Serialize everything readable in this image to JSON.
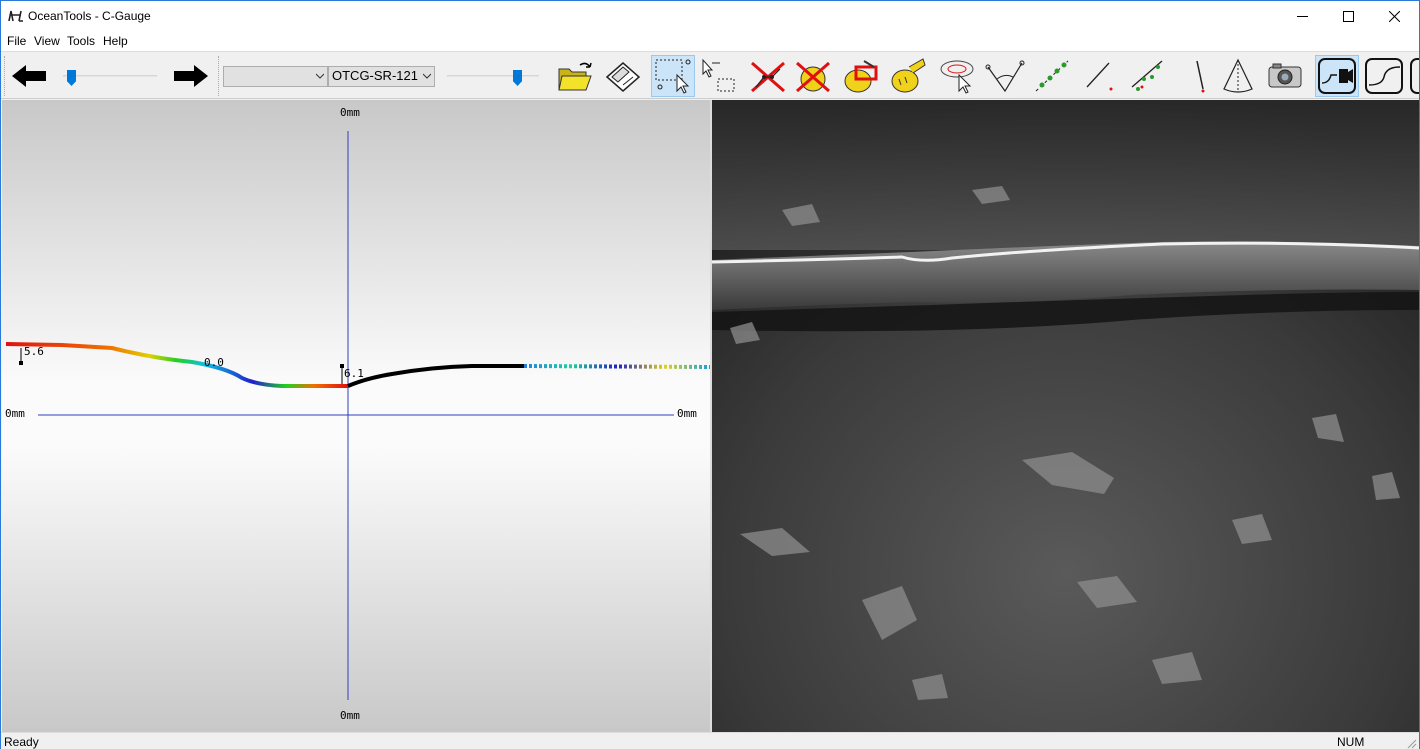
{
  "window": {
    "title": "OceanTools - C-Gauge",
    "controls": [
      "minimize-icon",
      "maximize-icon",
      "close-icon"
    ]
  },
  "menu": {
    "items": [
      {
        "label": "File"
      },
      {
        "label": "View"
      },
      {
        "label": "Tools"
      },
      {
        "label": "Help"
      }
    ]
  },
  "toolbar": {
    "prev_icon": "arrow-left-icon",
    "next_icon": "arrow-right-icon",
    "combo1_value": "",
    "combo2_value": "OTCG-SR-121",
    "tools": [
      {
        "icon": "open-folder-icon"
      },
      {
        "icon": "save-disk-icon"
      },
      {
        "icon": "select-points-icon"
      },
      {
        "icon": "select-rectangle-icon"
      },
      {
        "icon": "delete-points-icon"
      },
      {
        "icon": "delete-all-icon"
      },
      {
        "icon": "clear-measure-icon"
      },
      {
        "icon": "tape-measure-icon"
      },
      {
        "icon": "rotate-icon"
      },
      {
        "icon": "angle-icon"
      },
      {
        "icon": "point-line-icon"
      },
      {
        "icon": "line-icon"
      },
      {
        "icon": "point-fit-icon"
      },
      {
        "icon": "vertical-line-icon"
      },
      {
        "icon": "cone-icon"
      },
      {
        "icon": "camera-icon"
      },
      {
        "icon": "profile-camera-icon"
      },
      {
        "icon": "curve-icon"
      }
    ],
    "active_tools": [
      "select-points-icon",
      "profile-camera-icon"
    ]
  },
  "profile": {
    "top_axis_label": "0mm",
    "bottom_axis_label": "0mm",
    "left_axis_label": "0mm",
    "right_axis_label": "0mm",
    "measure_labels": [
      "5.6",
      "0.0",
      "6.1"
    ]
  },
  "status": {
    "left": "Ready",
    "right": "NUM"
  },
  "colors": {
    "axis": "#2f3fbf",
    "active_tool_bg": "#cce4f7",
    "title_border": "#2b78d8"
  }
}
